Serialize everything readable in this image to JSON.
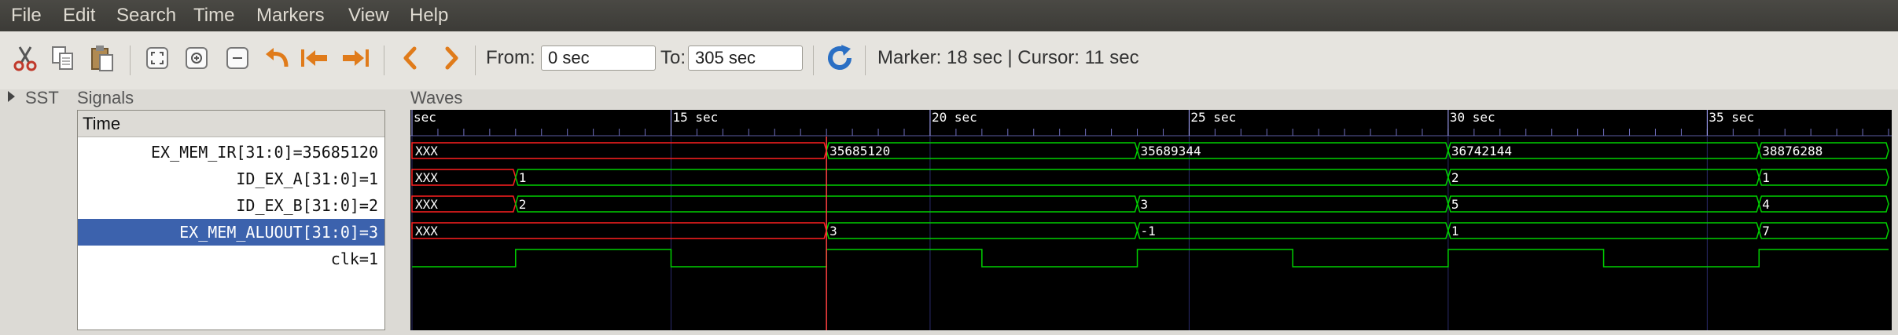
{
  "menu": [
    "File",
    "Edit",
    "Search",
    "Time",
    "Markers",
    "View",
    "Help"
  ],
  "toolbar": {
    "icons": [
      "cut-icon",
      "copy-icon",
      "paste-icon",
      "zoom-fit-icon",
      "zoom-in-icon",
      "zoom-out-icon",
      "undo-zoom-icon",
      "zoom-to-start-icon",
      "zoom-to-end-icon",
      "prev-edge-icon",
      "next-edge-icon",
      "reload-icon"
    ],
    "from_label": "From:",
    "from_value": "0 sec",
    "to_label": "To:",
    "to_value": "305 sec",
    "marker_text": "Marker: 18 sec  |  Cursor: 11 sec"
  },
  "sst": {
    "label": "SST"
  },
  "signals": {
    "title": "Signals",
    "header": "Time",
    "rows": [
      {
        "label": "EX_MEM_IR[31:0]=35685120",
        "selected": false
      },
      {
        "label": "ID_EX_A[31:0]=1",
        "selected": false
      },
      {
        "label": "ID_EX_B[31:0]=2",
        "selected": false
      },
      {
        "label": "EX_MEM_ALUOUT[31:0]=3",
        "selected": true
      },
      {
        "label": "clk=1",
        "selected": false
      }
    ]
  },
  "waves": {
    "title": "Waves",
    "time_start": 10,
    "time_end": 38.5,
    "marker_time": 18,
    "ticks": [
      {
        "t": 10,
        "label": "sec"
      },
      {
        "t": 15,
        "label": "15 sec"
      },
      {
        "t": 20,
        "label": "20 sec"
      },
      {
        "t": 25,
        "label": "25 sec"
      },
      {
        "t": 30,
        "label": "30 sec"
      },
      {
        "t": 35,
        "label": "35 sec"
      }
    ],
    "buses": [
      {
        "name": "EX_MEM_IR",
        "segments": [
          {
            "t0": 10,
            "t1": 18,
            "v": "XXX",
            "x": true
          },
          {
            "t0": 18,
            "t1": 24,
            "v": "35685120"
          },
          {
            "t0": 24,
            "t1": 30,
            "v": "35689344"
          },
          {
            "t0": 30,
            "t1": 36,
            "v": "36742144"
          },
          {
            "t0": 36,
            "t1": 38.5,
            "v": "38876288"
          }
        ]
      },
      {
        "name": "ID_EX_A",
        "segments": [
          {
            "t0": 10,
            "t1": 12,
            "v": "XXX",
            "x": true
          },
          {
            "t0": 12,
            "t1": 30,
            "v": "1"
          },
          {
            "t0": 30,
            "t1": 36,
            "v": "2"
          },
          {
            "t0": 36,
            "t1": 38.5,
            "v": "1"
          }
        ]
      },
      {
        "name": "ID_EX_B",
        "segments": [
          {
            "t0": 10,
            "t1": 12,
            "v": "XXX",
            "x": true
          },
          {
            "t0": 12,
            "t1": 24,
            "v": "2"
          },
          {
            "t0": 24,
            "t1": 30,
            "v": "3"
          },
          {
            "t0": 30,
            "t1": 36,
            "v": "5"
          },
          {
            "t0": 36,
            "t1": 38.5,
            "v": "4"
          }
        ]
      },
      {
        "name": "EX_MEM_ALUOUT",
        "segments": [
          {
            "t0": 10,
            "t1": 18,
            "v": "XXX",
            "x": true
          },
          {
            "t0": 18,
            "t1": 24,
            "v": "3"
          },
          {
            "t0": 24,
            "t1": 30,
            "v": "-1"
          },
          {
            "t0": 30,
            "t1": 36,
            "v": "1"
          },
          {
            "t0": 36,
            "t1": 38.5,
            "v": "7"
          }
        ]
      }
    ],
    "clk": {
      "name": "clk",
      "period": 6,
      "first_rise": 12,
      "high_time": 3
    }
  },
  "colors": {
    "bus": "#00d000",
    "xval": "#ff2020",
    "marker": "#ff4040",
    "grid": "#2a2a6a",
    "text": "#ffffff"
  }
}
